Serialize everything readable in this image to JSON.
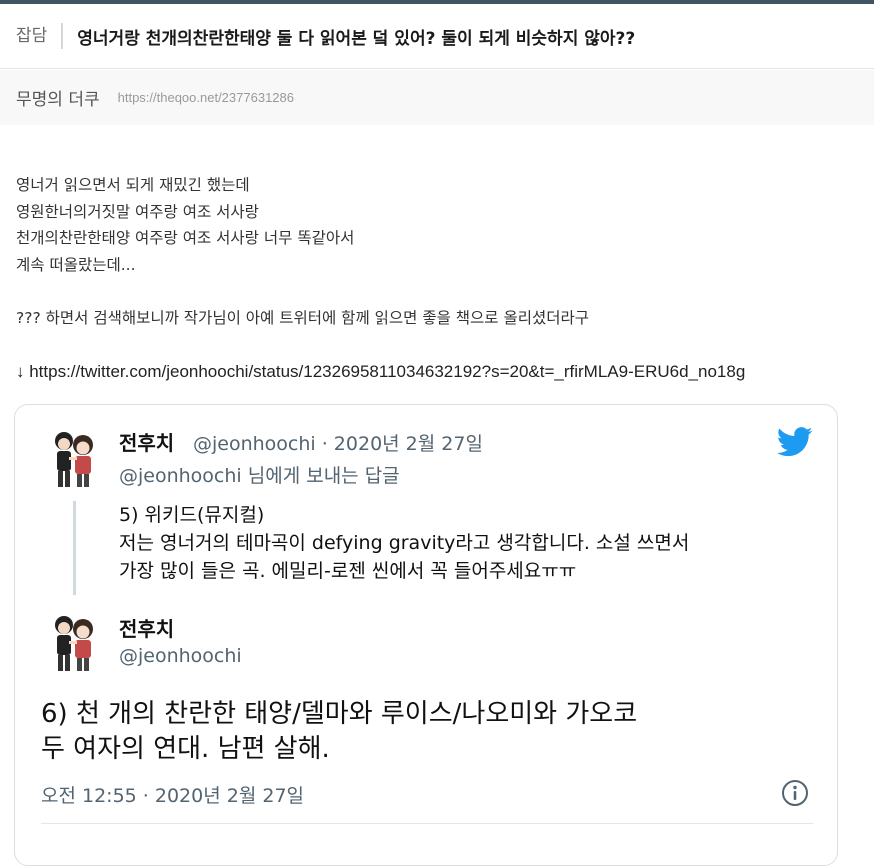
{
  "post": {
    "category": "잡담",
    "title": "영너거랑 천개의찬란한태양 둘 다 읽어본 덬 있어? 둘이 되게 비슷하지 않아??",
    "author": "무명의 더쿠",
    "url": "https://theqoo.net/2377631286"
  },
  "body": {
    "lines": [
      "영너거 읽으면서 되게 재밌긴 했는데",
      "영원한너의거짓말 여주랑 여조 서사랑",
      "천개의찬란한태양 여주랑 여조 서사랑 너무 똑같아서",
      "계속 떠올랐는데...",
      "",
      "??? 하면서 검색해보니까 작가님이 아예 트위터에 함께 읽으면 좋을 책으로 올리셨더라구"
    ],
    "link": "↓ https://twitter.com/jeonhoochi/status/1232695811034632192?s=20&t=_rfirMLA9-ERU6d_no18g"
  },
  "tweet": {
    "reply": {
      "name": "전후치",
      "handle_date": "@jeonhoochi · 2020년 2월 27일",
      "reply_to": "@jeonhoochi 님에게 보내는 답글",
      "lines": [
        "5) 위키드(뮤지컬)",
        "저는 영너거의 테마곡이 defying gravity라고 생각합니다. 소설 쓰면서",
        "가장 많이 들은 곡. 에밀리-로젠 씬에서 꼭 들어주세요ㅠㅠ"
      ]
    },
    "main": {
      "name": "전후치",
      "handle": "@jeonhoochi",
      "lines": [
        "6) 천 개의 찬란한 태양/델마와 루이스/나오미와 가오코",
        "두 여자의 연대. 남편 살해."
      ],
      "timestamp": "오전 12:55 · 2020년 2월 27일"
    },
    "icons": {
      "brand": "twitter-bird-icon",
      "info": "info-icon",
      "avatar": "cartoon-avatar"
    },
    "colors": {
      "twitter_blue": "#1d9bf0",
      "muted_text": "#536471"
    }
  }
}
